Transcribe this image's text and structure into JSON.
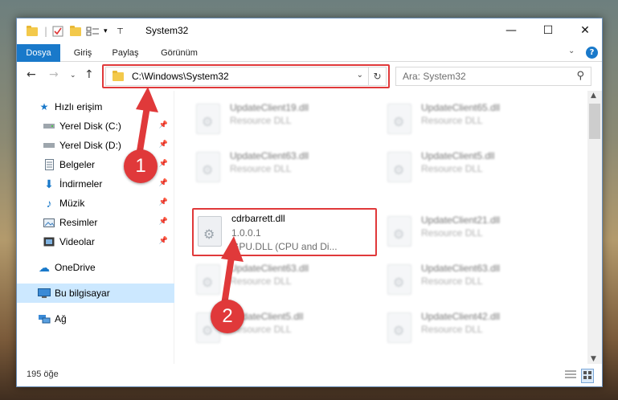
{
  "window": {
    "title": "System32",
    "controls": {
      "minimize": "—",
      "maximize": "☐",
      "close": "✕"
    }
  },
  "ribbon": {
    "tabs": [
      "Dosya",
      "Giriş",
      "Paylaş",
      "Görünüm"
    ]
  },
  "nav": {
    "address": "C:\\Windows\\System32",
    "search_placeholder": "Ara: System32"
  },
  "sidebar": {
    "items": [
      {
        "label": "Hızlı erişim",
        "icon": "star-icon"
      },
      {
        "label": "Yerel Disk (C:)",
        "icon": "drive-icon"
      },
      {
        "label": "Yerel Disk (D:)",
        "icon": "drive-icon"
      },
      {
        "label": "Belgeler",
        "icon": "document-icon"
      },
      {
        "label": "İndirmeler",
        "icon": "download-icon"
      },
      {
        "label": "Müzik",
        "icon": "music-icon"
      },
      {
        "label": "Resimler",
        "icon": "pictures-icon"
      },
      {
        "label": "Videolar",
        "icon": "video-icon"
      },
      {
        "label": "OneDrive",
        "icon": "cloud-icon"
      },
      {
        "label": "Bu bilgisayar",
        "icon": "computer-icon"
      },
      {
        "label": "Ağ",
        "icon": "network-icon"
      }
    ]
  },
  "files": [
    {
      "name": "UpdateClient19.dll",
      "type": "Resource DLL"
    },
    {
      "name": "UpdateClient65.dll",
      "type": "Resource DLL"
    },
    {
      "name": "UpdateClient63.dll",
      "type": "Resource DLL"
    },
    {
      "name": "UpdateClient5.dll",
      "type": "Resource DLL"
    },
    {
      "name": "cdrbarrett.dll",
      "version": "1.0.0.1",
      "type": "GPU.DLL (CPU and Di..."
    },
    {
      "name": "UpdateClient21.dll",
      "type": "Resource DLL"
    },
    {
      "name": "UpdateClient63.dll",
      "type": "Resource DLL"
    },
    {
      "name": "UpdateClient63.dll",
      "type": "Resource DLL"
    },
    {
      "name": "UpdateClient5.dll",
      "type": "Resource DLL"
    },
    {
      "name": "UpdateClient42.dll",
      "type": "Resource DLL"
    }
  ],
  "status": {
    "count": "195 öğe"
  },
  "annotations": {
    "step1": "1",
    "step2": "2",
    "color": "#e0393a"
  }
}
